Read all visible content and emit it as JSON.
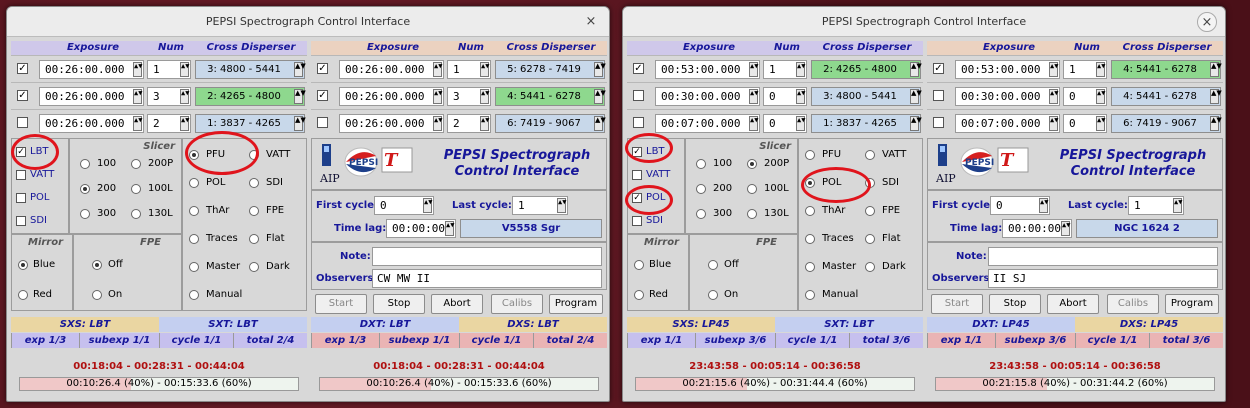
{
  "windows": [
    {
      "title": "PEPSI Spectrograph Control Interface",
      "close_glyph": "×",
      "halves": [
        {
          "header": {
            "exposure": "Exposure",
            "num": "Num",
            "cd": "Cross Disperser"
          },
          "rows": [
            {
              "checked": true,
              "exposure": "00:26:00.000",
              "num": "1",
              "cd": "3: 4800 - 5441",
              "cd_color": "#c8d8ea"
            },
            {
              "checked": true,
              "exposure": "00:26:00.000",
              "num": "3",
              "cd": "2: 4265 - 4800",
              "cd_color": "#8ed88e"
            },
            {
              "checked": false,
              "exposure": "00:26:00.000",
              "num": "2",
              "cd": "1: 3837 - 4265",
              "cd_color": "#c8d8ea"
            }
          ],
          "telescopes": [
            {
              "label": "LBT",
              "checked": true
            },
            {
              "label": "VATT",
              "checked": false
            },
            {
              "label": "POL",
              "checked": false
            },
            {
              "label": "SDI",
              "checked": false
            }
          ],
          "slicer_title": "Slicer",
          "slicers": [
            {
              "a": "100",
              "b": "200P",
              "sel": ""
            },
            {
              "a": "200",
              "b": "100L",
              "sel": "a"
            },
            {
              "a": "300",
              "b": "130L",
              "sel": ""
            }
          ],
          "mirror_title": "Mirror",
          "fpe_title": "FPE",
          "mirror": [
            {
              "label": "Blue",
              "sel": true
            },
            {
              "label": "Red",
              "sel": false
            }
          ],
          "fpe": [
            {
              "label": "Off",
              "sel": true
            },
            {
              "label": "On",
              "sel": false
            }
          ],
          "modes": [
            {
              "a": "PFU",
              "b": "VATT",
              "sel": "a"
            },
            {
              "a": "POL",
              "b": "SDI",
              "sel": ""
            },
            {
              "a": "ThAr",
              "b": "FPE",
              "sel": ""
            },
            {
              "a": "Traces",
              "b": "Flat",
              "sel": ""
            },
            {
              "a": "Master",
              "b": "Dark",
              "sel": ""
            },
            {
              "a": "Manual",
              "b": "",
              "sel": ""
            }
          ],
          "status": {
            "left": "SXS: LBT",
            "right": "SXT: LBT",
            "left_color": "#ead6a2",
            "right_color": "#c4cff0"
          },
          "counts": [
            "exp 1/3",
            "subexp 1/1",
            "cycle 1/1",
            "total 2/4"
          ],
          "time_range": "00:18:04 - 00:28:31 - 00:44:04",
          "progress_text": "00:10:26.4 (40%) - 00:15:33.6 (60%)",
          "progress_frac": 0.4
        },
        {
          "header": {
            "exposure": "Exposure",
            "num": "Num",
            "cd": "Cross Disperser"
          },
          "rows": [
            {
              "checked": true,
              "exposure": "00:26:00.000",
              "num": "1",
              "cd": "5: 6278 - 7419",
              "cd_color": "#c8d8ea"
            },
            {
              "checked": true,
              "exposure": "00:26:00.000",
              "num": "3",
              "cd": "4: 5441 - 6278",
              "cd_color": "#8ed88e"
            },
            {
              "checked": false,
              "exposure": "00:26:00.000",
              "num": "2",
              "cd": "6: 7419 - 9067",
              "cd_color": "#c8d8ea"
            }
          ],
          "pepsi_title": "PEPSI Spectrograph Control Interface",
          "aip": "AIP",
          "first_cycle_label": "First cycle:",
          "first_cycle": "0",
          "last_cycle_label": "Last cycle:",
          "last_cycle": "1",
          "time_lag_label": "Time lag:",
          "time_lag": "00:00:00",
          "target": "V5558 Sgr",
          "note_label": "Note:",
          "note": "",
          "observers_label": "Observers:",
          "observers": "CW MW II",
          "buttons": [
            "Start",
            "Stop",
            "Abort",
            "Calibs",
            "Program"
          ],
          "status": {
            "left": "DXT: LBT",
            "right": "DXS: LBT",
            "left_color": "#c4cff0",
            "right_color": "#ead6a2"
          },
          "counts": [
            "exp 1/3",
            "subexp 1/1",
            "cycle 1/1",
            "total 2/4"
          ],
          "time_range": "00:18:04 - 00:28:31 - 00:44:04",
          "progress_text": "00:10:26.4 (40%) - 00:15:33.6 (60%)",
          "progress_frac": 0.4
        }
      ]
    },
    {
      "title": "PEPSI Spectrograph Control Interface",
      "close_glyph": "×",
      "halves": [
        {
          "header": {
            "exposure": "Exposure",
            "num": "Num",
            "cd": "Cross Disperser"
          },
          "rows": [
            {
              "checked": true,
              "exposure": "00:53:00.000",
              "num": "1",
              "cd": "2: 4265 - 4800",
              "cd_color": "#8ed88e"
            },
            {
              "checked": false,
              "exposure": "00:30:00.000",
              "num": "0",
              "cd": "3: 4800 - 5441",
              "cd_color": "#c8d8ea"
            },
            {
              "checked": false,
              "exposure": "00:07:00.000",
              "num": "0",
              "cd": "1: 3837 - 4265",
              "cd_color": "#c8d8ea"
            }
          ],
          "telescopes": [
            {
              "label": "LBT",
              "checked": true
            },
            {
              "label": "VATT",
              "checked": false
            },
            {
              "label": "POL",
              "checked": true
            },
            {
              "label": "SDI",
              "checked": false
            }
          ],
          "slicer_title": "Slicer",
          "slicers": [
            {
              "a": "100",
              "b": "200P",
              "sel": "b"
            },
            {
              "a": "200",
              "b": "100L",
              "sel": ""
            },
            {
              "a": "300",
              "b": "130L",
              "sel": ""
            }
          ],
          "mirror_title": "Mirror",
          "fpe_title": "FPE",
          "mirror": [
            {
              "label": "Blue",
              "sel": false
            },
            {
              "label": "Red",
              "sel": false
            }
          ],
          "fpe": [
            {
              "label": "Off",
              "sel": false
            },
            {
              "label": "On",
              "sel": false
            }
          ],
          "modes": [
            {
              "a": "PFU",
              "b": "VATT",
              "sel": ""
            },
            {
              "a": "POL",
              "b": "SDI",
              "sel": "a"
            },
            {
              "a": "ThAr",
              "b": "FPE",
              "sel": ""
            },
            {
              "a": "Traces",
              "b": "Flat",
              "sel": ""
            },
            {
              "a": "Master",
              "b": "Dark",
              "sel": ""
            },
            {
              "a": "Manual",
              "b": "",
              "sel": ""
            }
          ],
          "status": {
            "left": "SXS: LP45",
            "right": "SXT: LBT",
            "left_color": "#ead6a2",
            "right_color": "#c4cff0"
          },
          "counts": [
            "exp 1/1",
            "subexp 3/6",
            "cycle 1/1",
            "total 3/6"
          ],
          "time_range": "23:43:58 - 00:05:14 - 00:36:58",
          "progress_text": "00:21:15.6 (40%) - 00:31:44.4 (60%)",
          "progress_frac": 0.4
        },
        {
          "header": {
            "exposure": "Exposure",
            "num": "Num",
            "cd": "Cross Disperser"
          },
          "rows": [
            {
              "checked": true,
              "exposure": "00:53:00.000",
              "num": "1",
              "cd": "4: 5441 - 6278",
              "cd_color": "#8ed88e"
            },
            {
              "checked": false,
              "exposure": "00:30:00.000",
              "num": "0",
              "cd": "4: 5441 - 6278",
              "cd_color": "#c8d8ea"
            },
            {
              "checked": false,
              "exposure": "00:07:00.000",
              "num": "0",
              "cd": "6: 7419 - 9067",
              "cd_color": "#c8d8ea"
            }
          ],
          "pepsi_title": "PEPSI Spectrograph Control Interface",
          "aip": "AIP",
          "first_cycle_label": "First cycle:",
          "first_cycle": "0",
          "last_cycle_label": "Last cycle:",
          "last_cycle": "1",
          "time_lag_label": "Time lag:",
          "time_lag": "00:00:00",
          "target": "NGC 1624 2",
          "note_label": "Note:",
          "note": "",
          "observers_label": "Observers:",
          "observers": "II SJ",
          "buttons": [
            "Start",
            "Stop",
            "Abort",
            "Calibs",
            "Program"
          ],
          "status": {
            "left": "DXT: LP45",
            "right": "DXS: LP45",
            "left_color": "#c4cff0",
            "right_color": "#ead6a2"
          },
          "counts": [
            "exp 1/1",
            "subexp 3/6",
            "cycle 1/1",
            "total 3/6"
          ],
          "time_range": "23:43:58 - 00:05:14 - 00:36:58",
          "progress_text": "00:21:15.8 (40%) - 00:31:44.2 (60%)",
          "progress_frac": 0.4
        }
      ]
    }
  ]
}
